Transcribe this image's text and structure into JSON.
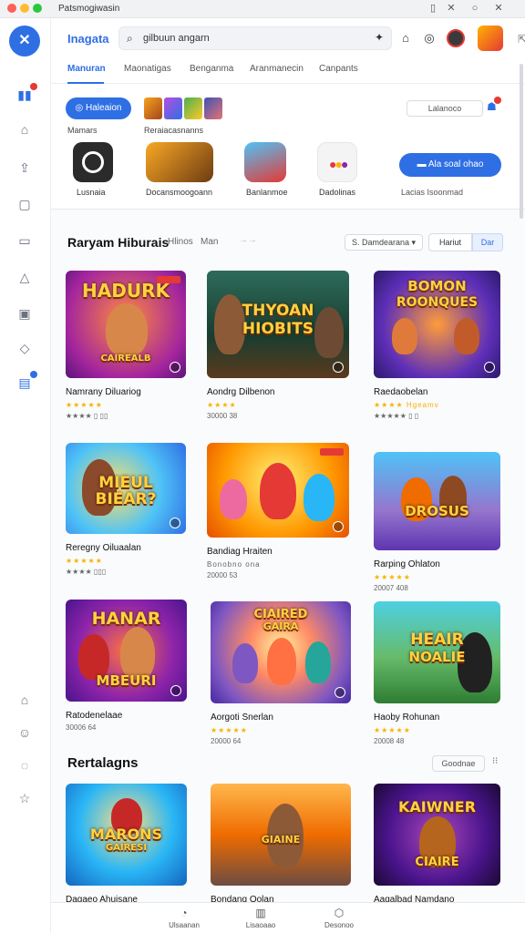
{
  "window": {
    "title": "Patsmogiwasin"
  },
  "topbar": {
    "app_name": "Inagata",
    "search_value": "gilbuun angarn"
  },
  "tabs": [
    "Manuran",
    "Maonatigas",
    "Benganma",
    "Aranmanecin",
    "Canpants"
  ],
  "featured": {
    "primary_button": "Haleaion",
    "labels": [
      "Mamars",
      "Reraiacasnanns"
    ],
    "outline_chip": "Lalanoco",
    "apps": [
      "Lusnaia",
      "Docansmoogoann",
      "Banlanmoe",
      "Dadolinas"
    ],
    "cta": "Ala soal ohao",
    "cta_sub": "Lacias Isoonmad"
  },
  "library": {
    "title": "Raryam Hiburais",
    "subtitle": "Hlinos",
    "subtitle2": "Man",
    "sort_label": "S. Damdearana",
    "segments": [
      "Hariut",
      "Dar"
    ]
  },
  "cards": [
    {
      "title": "HADURK",
      "title2": "CAIREALB",
      "name": "Namrany Diluariog",
      "stars": "★★★★★",
      "meta": "★★★★  ▯ ▯▯"
    },
    {
      "title": "THYOAN",
      "title2": "HIOBITS",
      "name": "Aondrg Dilbenon",
      "stars": "★★★★",
      "meta": "30000 38"
    },
    {
      "title": "BOMON",
      "title2": "ROONQUES",
      "name": "Raedaobelan",
      "stars": "★★★★ Hgeamv",
      "meta": "★★★★★ ▯ ▯"
    },
    {
      "title": "MIEUL",
      "title2": "BIEAR?",
      "name": "Reregny Oiluaalan",
      "stars": "★★★★★",
      "meta": "★★★★  ▯▯▯"
    },
    {
      "title": "",
      "title2": "",
      "name": "Bandiag Hraiten",
      "stars": "Bonobno ona",
      "meta": "20000 53"
    },
    {
      "title": "DROSUS",
      "title2": "",
      "name": "Rarping Ohlaton",
      "stars": "★★★★★",
      "meta": "20007 408"
    },
    {
      "title": "HANAR",
      "title2": "MBEURI",
      "name": "Ratodenelaae",
      "stars": "30006 64",
      "meta": ""
    },
    {
      "title": "CIAIRED",
      "title2": "GAIRA",
      "name": "Aorgoti Snerlan",
      "stars": "★★★★★",
      "meta": "20000 64"
    },
    {
      "title": "HEAIR",
      "title2": "NOALIE",
      "name": "Haoby Rohunan",
      "stars": "★★★★★",
      "meta": "20008 48"
    }
  ],
  "recommended": {
    "title": "Rertalagns",
    "chip": "Goodnae",
    "cards": [
      {
        "title": "MARONS",
        "title2": "GAIRESI",
        "name": "Dagaeo Ahuisane"
      },
      {
        "title": "",
        "title2": "GIAINE",
        "name": "Bondang Oolan"
      },
      {
        "title": "KAIWNER",
        "title2": "CIAIRE",
        "name": "Aagalbad Namdano"
      }
    ]
  },
  "bottomnav": [
    "Ulsaanan",
    "Lisaoaao",
    "Desonoo"
  ],
  "colors": {
    "accent": "#2f6fe4",
    "star": "#f5b301",
    "badge": "#e53935"
  }
}
